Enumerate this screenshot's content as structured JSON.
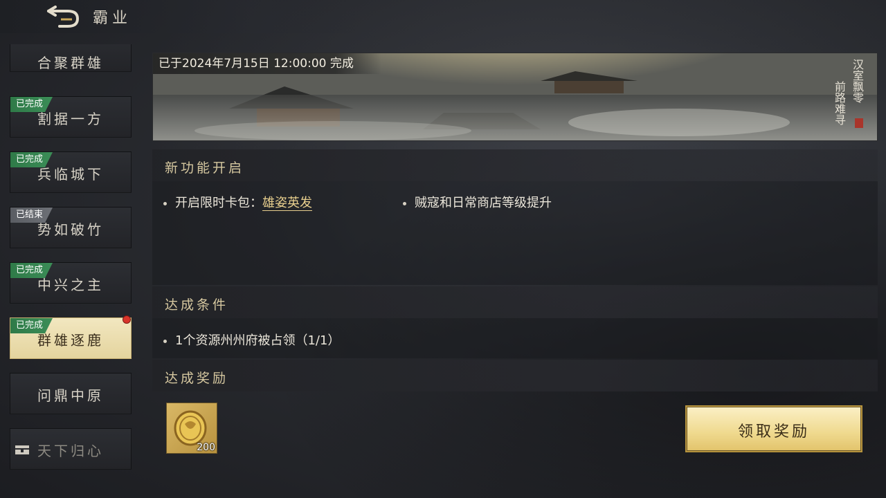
{
  "header": {
    "title": "霸业",
    "back_icon": "back-arrow-icon"
  },
  "sidebar": {
    "items": [
      {
        "label": "合聚群雄",
        "tag": ""
      },
      {
        "label": "割据一方",
        "tag": "已完成"
      },
      {
        "label": "兵临城下",
        "tag": "已完成"
      },
      {
        "label": "势如破竹",
        "tag": "已结束"
      },
      {
        "label": "中兴之主",
        "tag": "已完成"
      },
      {
        "label": "群雄逐鹿",
        "tag": "已完成"
      },
      {
        "label": "问鼎中原",
        "tag": ""
      },
      {
        "label": "天下归心",
        "tag": ""
      }
    ]
  },
  "banner": {
    "completed_text": "已于2024年7月15日 12:00:00 完成",
    "poem_col1": "汉室飘零",
    "poem_col2": "前路难寻"
  },
  "features": {
    "title": "新功能开启",
    "item1_prefix": "开启限时卡包：",
    "item1_link": "雄姿英发",
    "item2": "贼寇和日常商店等级提升"
  },
  "conditions": {
    "title": "达成条件",
    "item1": "1个资源州州府被占领（1/1）"
  },
  "rewards": {
    "title": "达成奖励",
    "item_icon": "gold-coin-icon",
    "item_count": "200",
    "claim_label": "领取奖励"
  },
  "colors": {
    "done_tag": "#3b8d57",
    "ended_tag": "#6d7076",
    "accent_gold": "#e8cf8e",
    "active_item": "#f2e7c0"
  }
}
